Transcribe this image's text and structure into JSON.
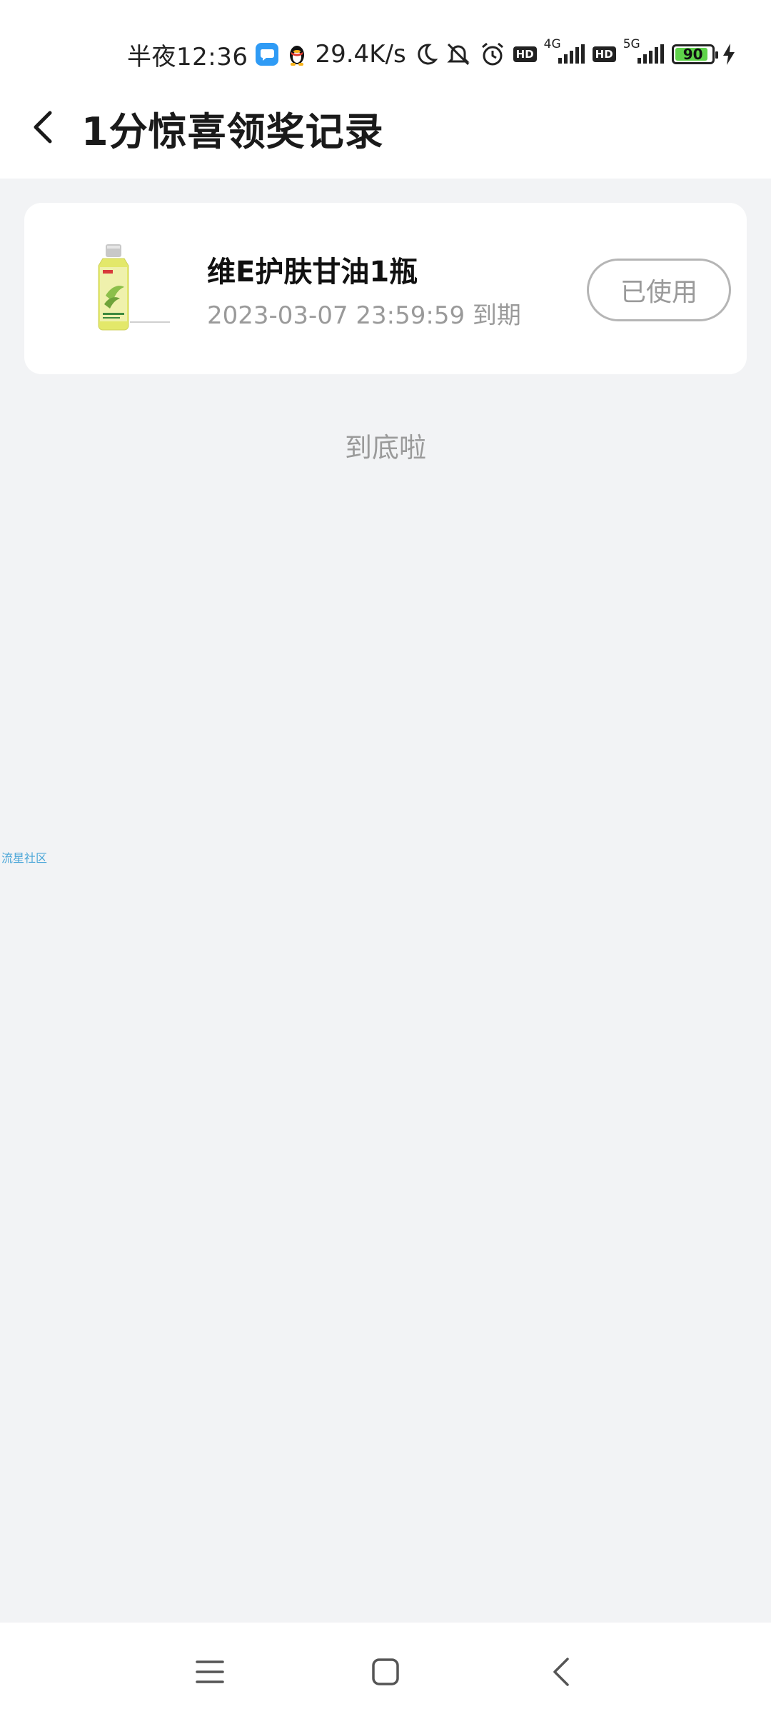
{
  "status_bar": {
    "time": "半夜12:36",
    "net_speed": "29.4K/s",
    "network_4g": "4G",
    "network_5g": "5G",
    "hd_label": "HD",
    "battery_level": "90",
    "battery_fraction": 0.9,
    "icons": [
      "chat-app-icon",
      "qq-penguin-icon",
      "moon-icon",
      "bell-muted-icon",
      "alarm-icon",
      "hd-icon",
      "signal-icon",
      "hd-icon",
      "signal-icon",
      "battery-icon",
      "charging-bolt-icon"
    ]
  },
  "header": {
    "back_icon": "chevron-left-icon",
    "title": "1分惊喜领奖记录"
  },
  "records": [
    {
      "name": "维E护肤甘油1瓶",
      "expiry": "2023-03-07 23:59:59 到期",
      "status_label": "已使用",
      "image": "glycerin-bottle-image"
    }
  ],
  "list_end_text": "到底啦",
  "watermark": "流星社区",
  "nav_bar": {
    "icons": [
      "menu-icon",
      "home-square-icon",
      "back-triangle-icon"
    ]
  },
  "colors": {
    "background": "#f2f3f5",
    "card": "#ffffff",
    "muted_text": "#9a9a9a",
    "watermark": "#4aa6d8",
    "battery_fill": "#5fd34a"
  }
}
